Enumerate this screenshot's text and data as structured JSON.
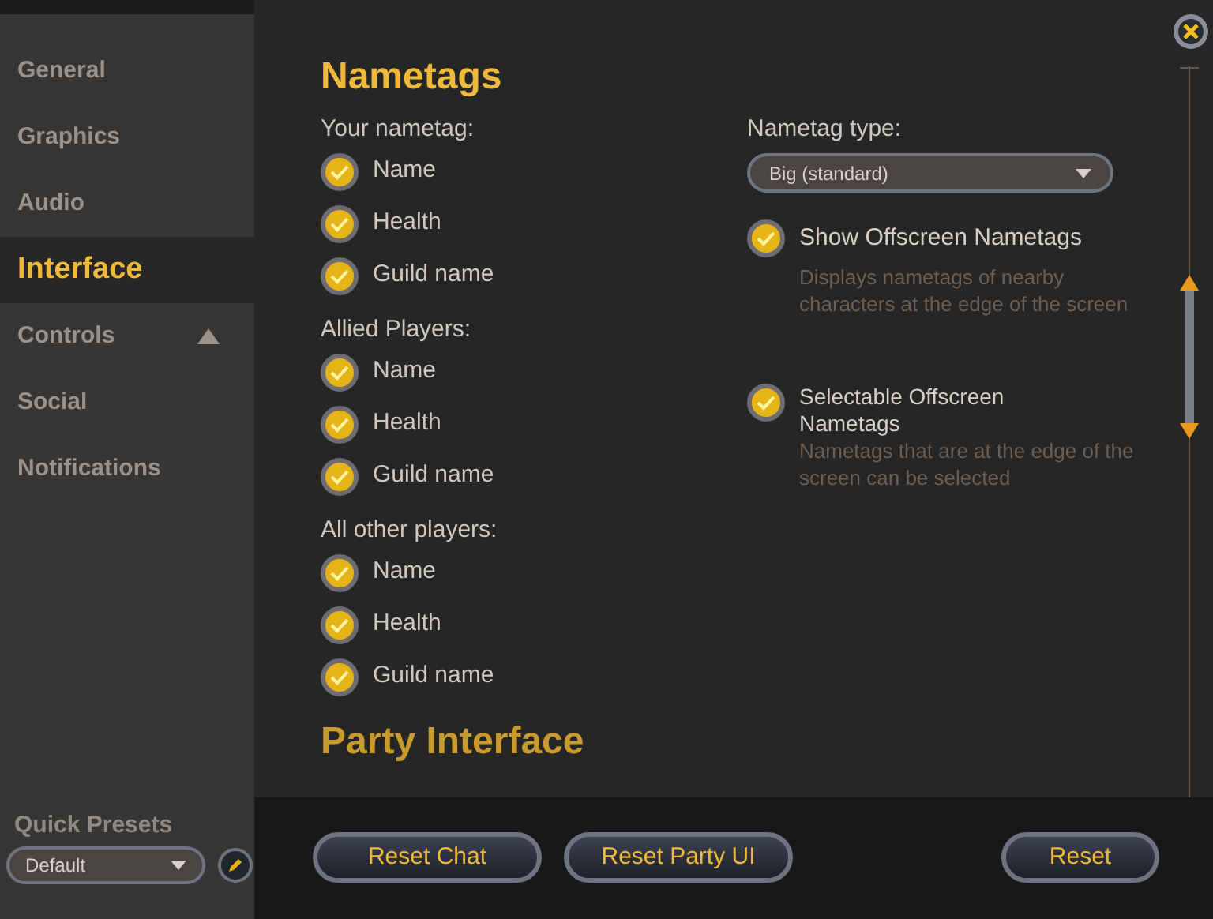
{
  "sidebar": {
    "items": [
      {
        "label": "General",
        "selected": false,
        "expandable": false
      },
      {
        "label": "Graphics",
        "selected": false,
        "expandable": false
      },
      {
        "label": "Audio",
        "selected": false,
        "expandable": false
      },
      {
        "label": "Interface",
        "selected": true,
        "expandable": false
      },
      {
        "label": "Controls",
        "selected": false,
        "expandable": true
      },
      {
        "label": "Social",
        "selected": false,
        "expandable": false
      },
      {
        "label": "Notifications",
        "selected": false,
        "expandable": false
      }
    ],
    "quick_presets": {
      "title": "Quick Presets",
      "value": "Default"
    }
  },
  "nametags": {
    "title": "Nametags",
    "groups": [
      {
        "label": "Your nametag:",
        "options": [
          {
            "label": "Name",
            "checked": true
          },
          {
            "label": "Health",
            "checked": true
          },
          {
            "label": "Guild name",
            "checked": true
          }
        ]
      },
      {
        "label": "Allied Players:",
        "options": [
          {
            "label": "Name",
            "checked": true
          },
          {
            "label": "Health",
            "checked": true
          },
          {
            "label": "Guild name",
            "checked": true
          }
        ]
      },
      {
        "label": "All other players:",
        "options": [
          {
            "label": "Name",
            "checked": true
          },
          {
            "label": "Health",
            "checked": true
          },
          {
            "label": "Guild name",
            "checked": true
          }
        ]
      }
    ],
    "nametag_type": {
      "label": "Nametag type:",
      "value": "Big (standard)"
    },
    "offscreen_options": [
      {
        "label": "Show Offscreen Nametags",
        "checked": true,
        "description": "Displays nametags of nearby characters at the edge of the screen"
      },
      {
        "label": "Selectable Offscreen Nametags",
        "checked": true,
        "description": "Nametags that are at the edge of the screen can be selected"
      }
    ]
  },
  "party_interface": {
    "title": "Party Interface"
  },
  "buttons": [
    "Reset Chat",
    "Reset Party UI"
  ],
  "reset_button": "Reset"
}
